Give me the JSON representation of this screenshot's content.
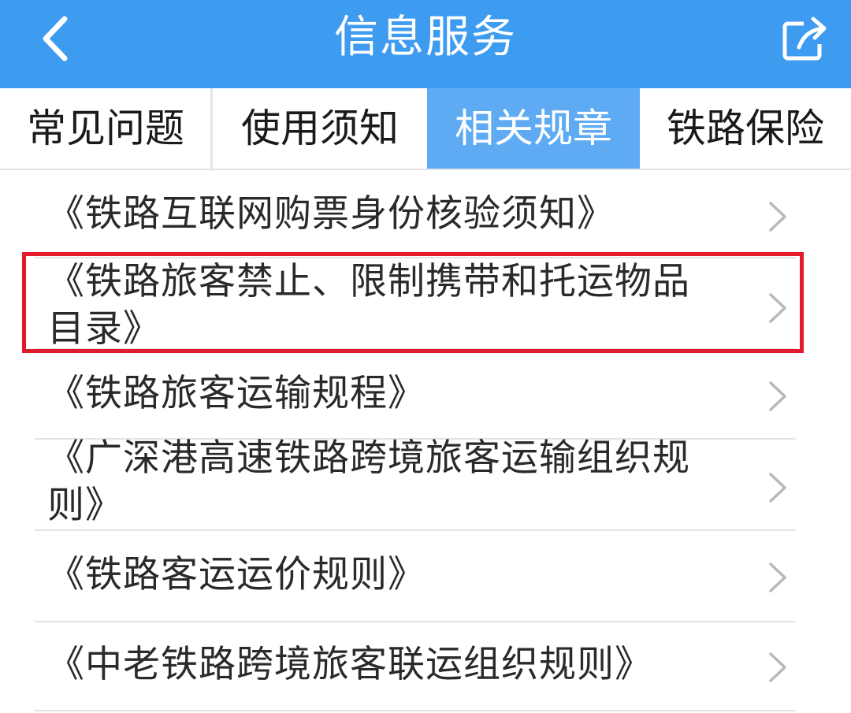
{
  "header": {
    "title": "信息服务",
    "back_icon": "chevron-left-icon",
    "share_icon": "share-icon",
    "background": "#3d9bf0"
  },
  "tabs": [
    {
      "label": "常见问题",
      "active": false
    },
    {
      "label": "使用须知",
      "active": false
    },
    {
      "label": "相关规章",
      "active": true
    },
    {
      "label": "铁路保险",
      "active": false
    }
  ],
  "items": [
    {
      "lines": [
        "《铁路互联网购票身份核验须知》"
      ],
      "highlighted": false
    },
    {
      "lines": [
        "《铁路旅客禁止、限制携带和托运物品",
        "目录》"
      ],
      "highlighted": true
    },
    {
      "lines": [
        "《铁路旅客运输规程》"
      ],
      "highlighted": false
    },
    {
      "lines": [
        "《广深港高速铁路跨境旅客运输组织规",
        "则》"
      ],
      "highlighted": false
    },
    {
      "lines": [
        "《铁路客运运价规则》"
      ],
      "highlighted": false
    },
    {
      "lines": [
        "《中老铁路跨境旅客联运组织规则》"
      ],
      "highlighted": false
    }
  ],
  "colors": {
    "accent": "#3d9bf0",
    "active_tab": "#5eabf4",
    "highlight_border": "#e11b2b"
  }
}
